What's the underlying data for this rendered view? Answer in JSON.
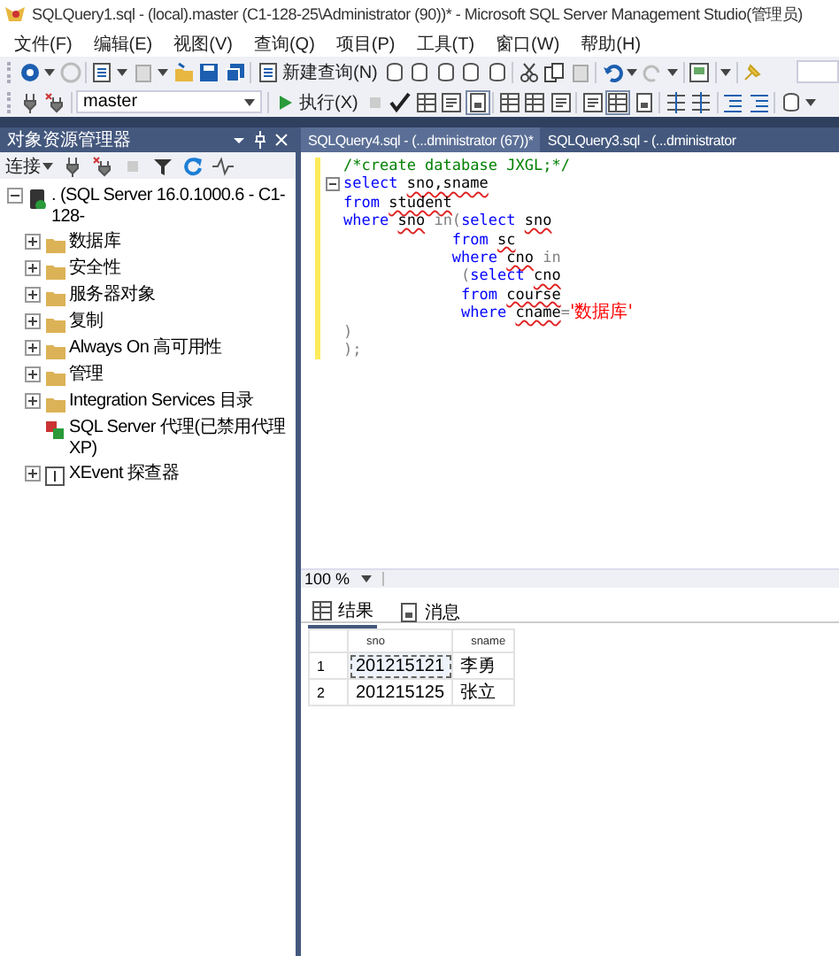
{
  "window": {
    "title": "SQLQuery1.sql - (local).master (C1-128-25\\Administrator (90))* - Microsoft SQL Server Management Studio(管理员)"
  },
  "menu": [
    "文件(F)",
    "编辑(E)",
    "视图(V)",
    "查询(Q)",
    "项目(P)",
    "工具(T)",
    "窗口(W)",
    "帮助(H)"
  ],
  "toolbar": {
    "new_query": "新建查询(N)",
    "database": "master",
    "execute": "执行(X)"
  },
  "object_explorer": {
    "title": "对象资源管理器",
    "connect": "连接",
    "tree": [
      {
        "label": ". (SQL Server 16.0.1000.6 - C1-128-",
        "kind": "server",
        "expanded": true,
        "children": [
          {
            "label": "数据库",
            "kind": "folder",
            "expanded": false
          },
          {
            "label": "安全性",
            "kind": "folder",
            "expanded": false
          },
          {
            "label": "服务器对象",
            "kind": "folder",
            "expanded": false
          },
          {
            "label": "复制",
            "kind": "folder",
            "expanded": false
          },
          {
            "label": "Always On 高可用性",
            "kind": "folder",
            "expanded": false
          },
          {
            "label": "管理",
            "kind": "folder",
            "expanded": false
          },
          {
            "label": "Integration Services 目录",
            "kind": "folder",
            "expanded": false
          },
          {
            "label": "SQL Server 代理(已禁用代理 XP)",
            "kind": "agent"
          },
          {
            "label": "XEvent 探查器",
            "kind": "xevent",
            "expanded": false
          }
        ]
      }
    ]
  },
  "editor_tabs": [
    {
      "label": "SQLQuery4.sql - (...dministrator (67))*",
      "selected": true
    },
    {
      "label": "SQLQuery3.sql - (...dministrator",
      "selected": false
    }
  ],
  "code": [
    [
      {
        "text": "/*create database JXGL;*/",
        "kind": "comment"
      }
    ],
    [
      {
        "text": "select ",
        "kind": "keyword"
      },
      {
        "text": "sno,sname",
        "kind": "plain",
        "error": true
      }
    ],
    [
      {
        "text": "from ",
        "kind": "keyword"
      },
      {
        "text": "student",
        "kind": "plain",
        "error": true
      }
    ],
    [
      {
        "text": "where ",
        "kind": "keyword"
      },
      {
        "text": "sno",
        "kind": "plain",
        "error": true
      },
      {
        "text": " in(",
        "kind": "operator"
      },
      {
        "text": "select ",
        "kind": "keyword"
      },
      {
        "text": "sno",
        "kind": "plain",
        "error": true
      }
    ],
    [
      {
        "text": "            from ",
        "kind": "keyword"
      },
      {
        "text": "sc",
        "kind": "plain",
        "error": true
      }
    ],
    [
      {
        "text": "            where ",
        "kind": "keyword"
      },
      {
        "text": "cno",
        "kind": "plain",
        "error": true
      },
      {
        "text": " in",
        "kind": "operator"
      }
    ],
    [
      {
        "text": "             (",
        "kind": "operator"
      },
      {
        "text": "select ",
        "kind": "keyword"
      },
      {
        "text": "cno",
        "kind": "plain",
        "error": true
      }
    ],
    [
      {
        "text": "             from ",
        "kind": "keyword"
      },
      {
        "text": "course",
        "kind": "plain",
        "error": true
      }
    ],
    [
      {
        "text": "             where ",
        "kind": "keyword"
      },
      {
        "text": "cname",
        "kind": "plain",
        "error": true
      },
      {
        "text": "=",
        "kind": "operator"
      },
      {
        "text": "'数据库'",
        "kind": "string"
      }
    ],
    [
      {
        "text": ")",
        "kind": "operator"
      }
    ],
    [
      {
        "text": ");",
        "kind": "operator"
      }
    ]
  ],
  "zoom": "100 %",
  "result_tabs": [
    {
      "label": "结果",
      "kind": "grid",
      "selected": true
    },
    {
      "label": "消息",
      "kind": "messages",
      "selected": false
    }
  ],
  "results": {
    "columns": [
      "sno",
      "sname"
    ],
    "rows": [
      {
        "number": "1",
        "cells": [
          "201215121",
          "李勇"
        ]
      },
      {
        "number": "2",
        "cells": [
          "201215125",
          "张立"
        ]
      }
    ]
  }
}
